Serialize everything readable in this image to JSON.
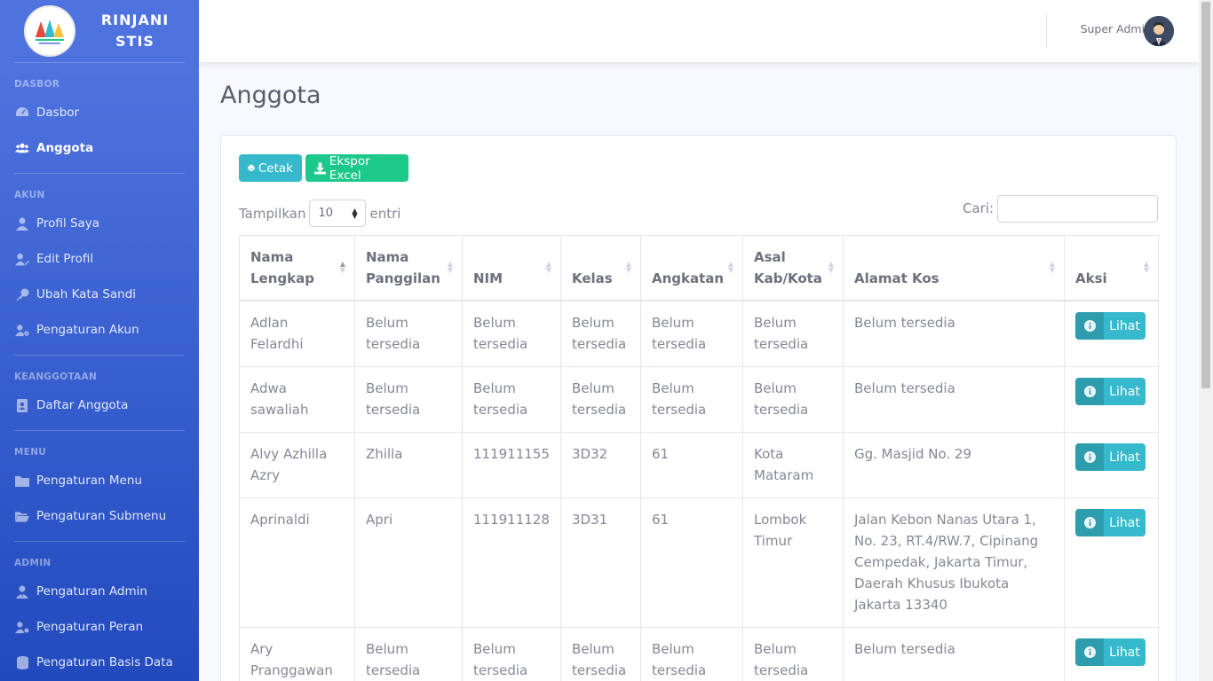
{
  "brand": {
    "line1": "RINJANI",
    "line2": "STIS"
  },
  "sidebar": {
    "sections": [
      {
        "heading": "DASBOR",
        "items": [
          {
            "label": "Dasbor",
            "icon": "tachometer-icon",
            "active": false
          },
          {
            "label": "Anggota",
            "icon": "users-icon",
            "active": true
          }
        ]
      },
      {
        "heading": "AKUN",
        "items": [
          {
            "label": "Profil Saya",
            "icon": "user-icon"
          },
          {
            "label": "Edit Profil",
            "icon": "user-edit-icon"
          },
          {
            "label": "Ubah Kata Sandi",
            "icon": "key-icon"
          },
          {
            "label": "Pengaturan Akun",
            "icon": "user-cog-icon"
          }
        ]
      },
      {
        "heading": "KEANGGOTAAN",
        "items": [
          {
            "label": "Daftar Anggota",
            "icon": "address-book-icon"
          }
        ]
      },
      {
        "heading": "MENU",
        "items": [
          {
            "label": "Pengaturan Menu",
            "icon": "folder-icon"
          },
          {
            "label": "Pengaturan Submenu",
            "icon": "folder-open-icon"
          }
        ]
      },
      {
        "heading": "ADMIN",
        "items": [
          {
            "label": "Pengaturan Admin",
            "icon": "user-tie-icon"
          },
          {
            "label": "Pengaturan Peran",
            "icon": "user-tag-icon"
          },
          {
            "label": "Pengaturan Basis Data",
            "icon": "database-icon"
          }
        ]
      }
    ]
  },
  "topbar": {
    "user_name": "Super Admin"
  },
  "page": {
    "title": "Anggota"
  },
  "toolbar": {
    "print_label": "Cetak",
    "excel_label": "Ekspor Excel"
  },
  "table_controls": {
    "show_label": "Tampilkan",
    "page_length": "10",
    "entries_label": "entri",
    "search_label": "Cari:"
  },
  "table": {
    "headers": [
      {
        "line1": "Nama",
        "line2": "Lengkap"
      },
      {
        "line1": "Nama",
        "line2": "Panggilan"
      },
      {
        "line1": "",
        "line2": "NIM"
      },
      {
        "line1": "",
        "line2": "Kelas"
      },
      {
        "line1": "",
        "line2": "Angkatan"
      },
      {
        "line1": "Asal",
        "line2": "Kab/Kota"
      },
      {
        "line1": "",
        "line2": "Alamat Kos"
      },
      {
        "line1": "",
        "line2": "Aksi"
      }
    ],
    "action_label": "Lihat",
    "rows": [
      [
        "Adlan Felardhi",
        "Belum tersedia",
        "Belum tersedia",
        "Belum tersedia",
        "Belum tersedia",
        "Belum tersedia",
        "Belum tersedia"
      ],
      [
        "Adwa sawaliah",
        "Belum tersedia",
        "Belum tersedia",
        "Belum tersedia",
        "Belum tersedia",
        "Belum tersedia",
        "Belum tersedia"
      ],
      [
        "Alvy Azhilla Azry",
        "Zhilla",
        "111911155",
        "3D32",
        "61",
        "Kota Mataram",
        "Gg. Masjid No. 29"
      ],
      [
        "Aprinaldi",
        "Apri",
        "111911128",
        "3D31",
        "61",
        "Lombok Timur",
        "Jalan Kebon Nanas Utara 1, No. 23, RT.4/RW.7, Cipinang Cempedak, Jakarta Timur, Daerah Khusus Ibukota Jakarta 13340"
      ],
      [
        "Ary Pranggawan",
        "Belum tersedia",
        "Belum tersedia",
        "Belum tersedia",
        "Belum tersedia",
        "Belum tersedia",
        "Belum tersedia"
      ]
    ]
  },
  "colors": {
    "sidebar_start": "#4e73df",
    "sidebar_end": "#224abe",
    "info": "#36b9cc",
    "success": "#1cc88a"
  }
}
